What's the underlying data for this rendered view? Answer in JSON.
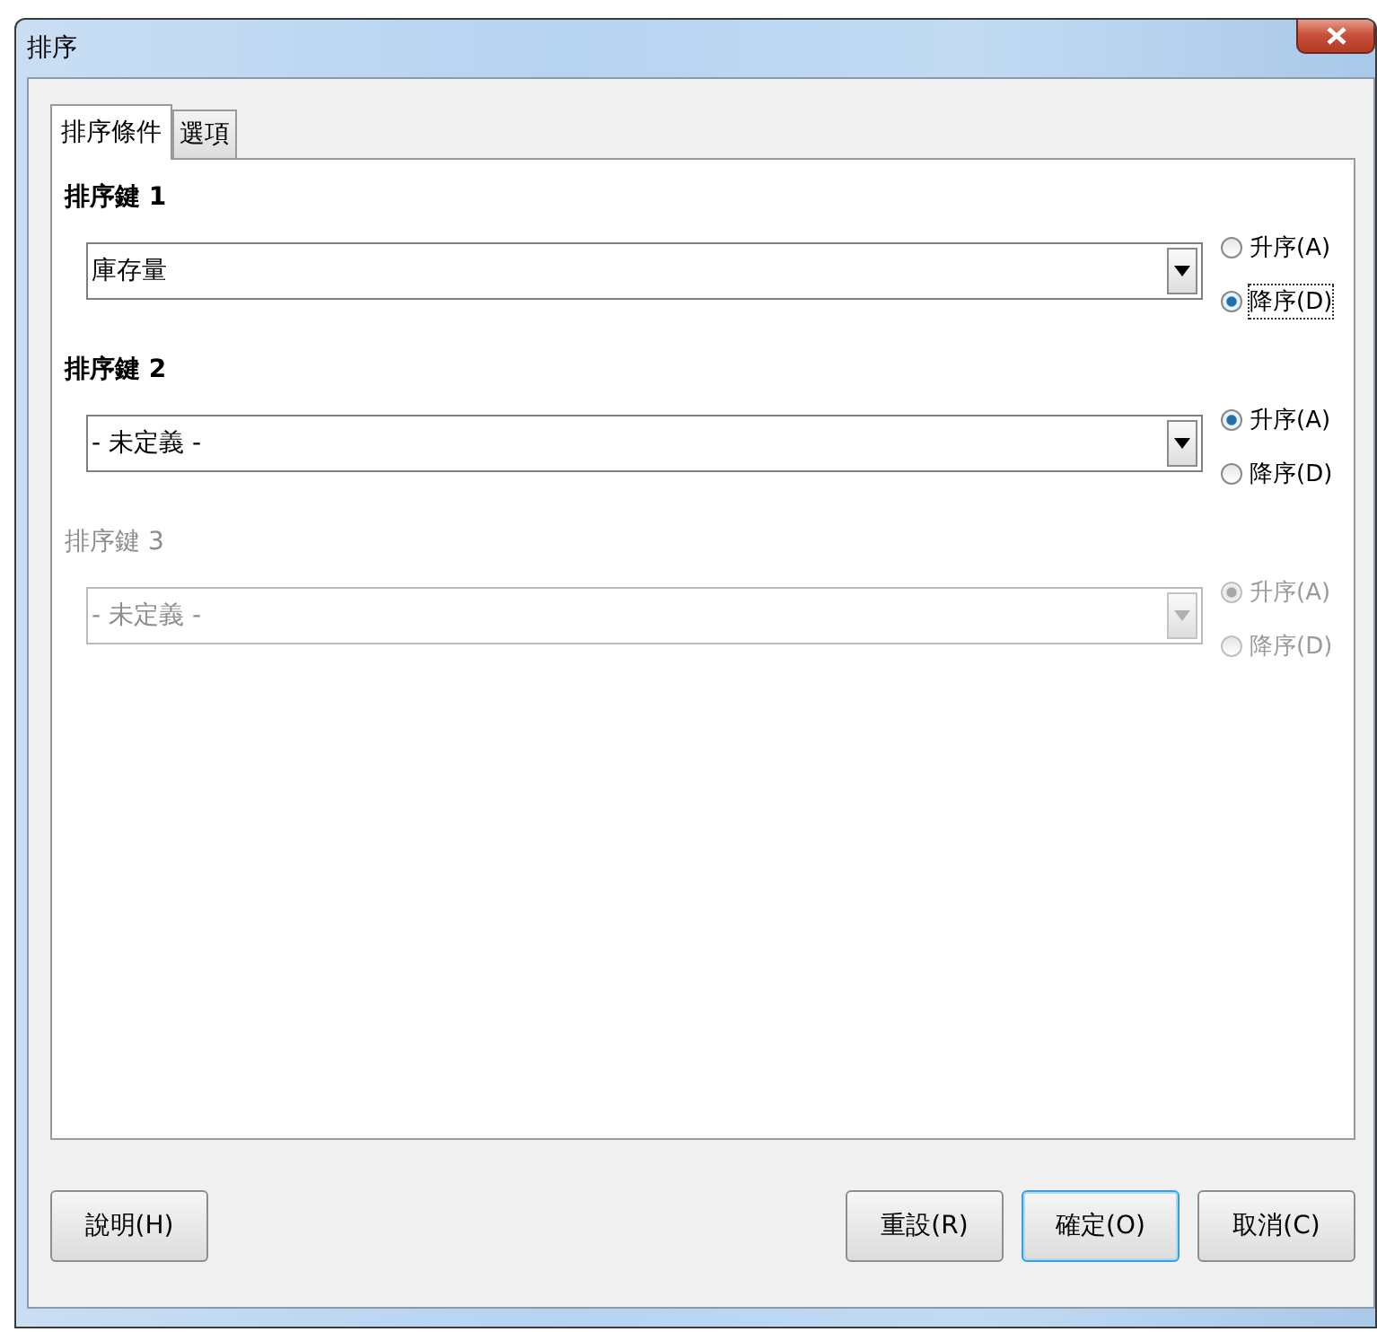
{
  "window": {
    "title": "排序"
  },
  "tabs": [
    {
      "label": "排序條件",
      "selected": true
    },
    {
      "label": "選項",
      "selected": false
    }
  ],
  "sort_keys": [
    {
      "label": "排序鍵 1",
      "disabled": false,
      "value": "庫存量",
      "options": [
        {
          "label": "升序(A)",
          "selected": false,
          "focused": false
        },
        {
          "label": "降序(D)",
          "selected": true,
          "focused": true
        }
      ]
    },
    {
      "label": "排序鍵 2",
      "disabled": false,
      "value": "- 未定義 -",
      "options": [
        {
          "label": "升序(A)",
          "selected": true,
          "focused": false
        },
        {
          "label": "降序(D)",
          "selected": false,
          "focused": false
        }
      ]
    },
    {
      "label": "排序鍵 3",
      "disabled": true,
      "value": "- 未定義 -",
      "options": [
        {
          "label": "升序(A)",
          "selected": true,
          "focused": false
        },
        {
          "label": "降序(D)",
          "selected": false,
          "focused": false
        }
      ]
    }
  ],
  "buttons": [
    {
      "label": "說明(H)",
      "default": false
    },
    {
      "label": "重設(R)",
      "default": false
    },
    {
      "label": "確定(O)",
      "default": true
    },
    {
      "label": "取消(C)",
      "default": false
    }
  ]
}
